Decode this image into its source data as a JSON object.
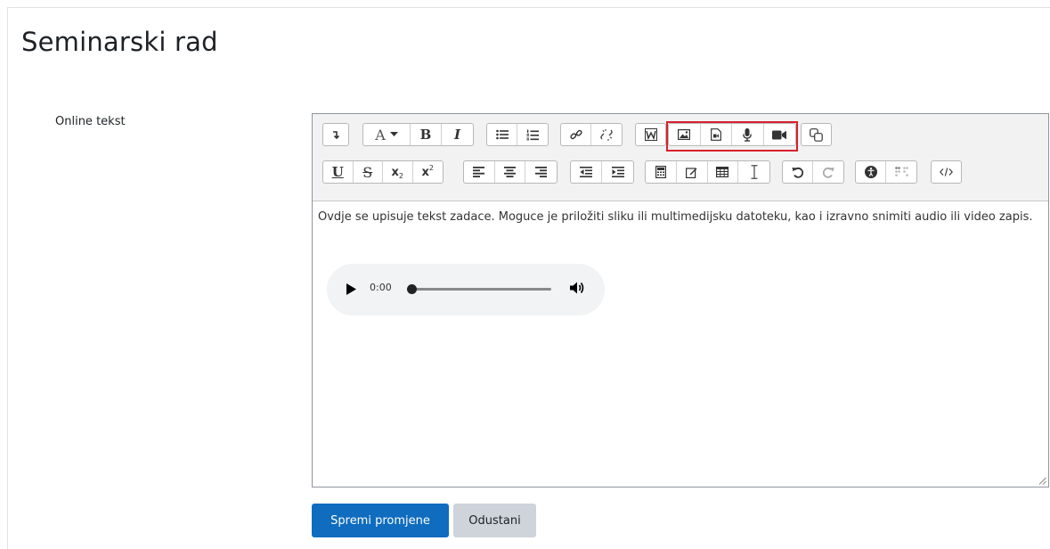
{
  "page": {
    "title": "Seminarski rad"
  },
  "field": {
    "label": "Online tekst"
  },
  "editor": {
    "text": "Ovdje se upisuje tekst zadace. Moguce je priložiti sliku ili multimedijsku datoteku, kao i izravno snimiti audio ili video zapis.",
    "toolbar": {
      "font_glyph": "A",
      "bold": "B",
      "italic": "I",
      "underline": "U",
      "strike": "S",
      "subscript": "x",
      "subscript_mark": "2",
      "superscript": "x",
      "superscript_mark": "2",
      "highlighted_group": [
        "image-icon",
        "media-icon",
        "microphone-icon",
        "video-camera-icon"
      ]
    },
    "audio_player": {
      "time": "0:00"
    }
  },
  "actions": {
    "save_label": "Spremi promjene",
    "cancel_label": "Odustani"
  },
  "colors": {
    "primary": "#0f6cbf",
    "secondary": "#ced4da",
    "highlight": "#d9202c",
    "toolbar_bg": "#f2f2f2"
  }
}
